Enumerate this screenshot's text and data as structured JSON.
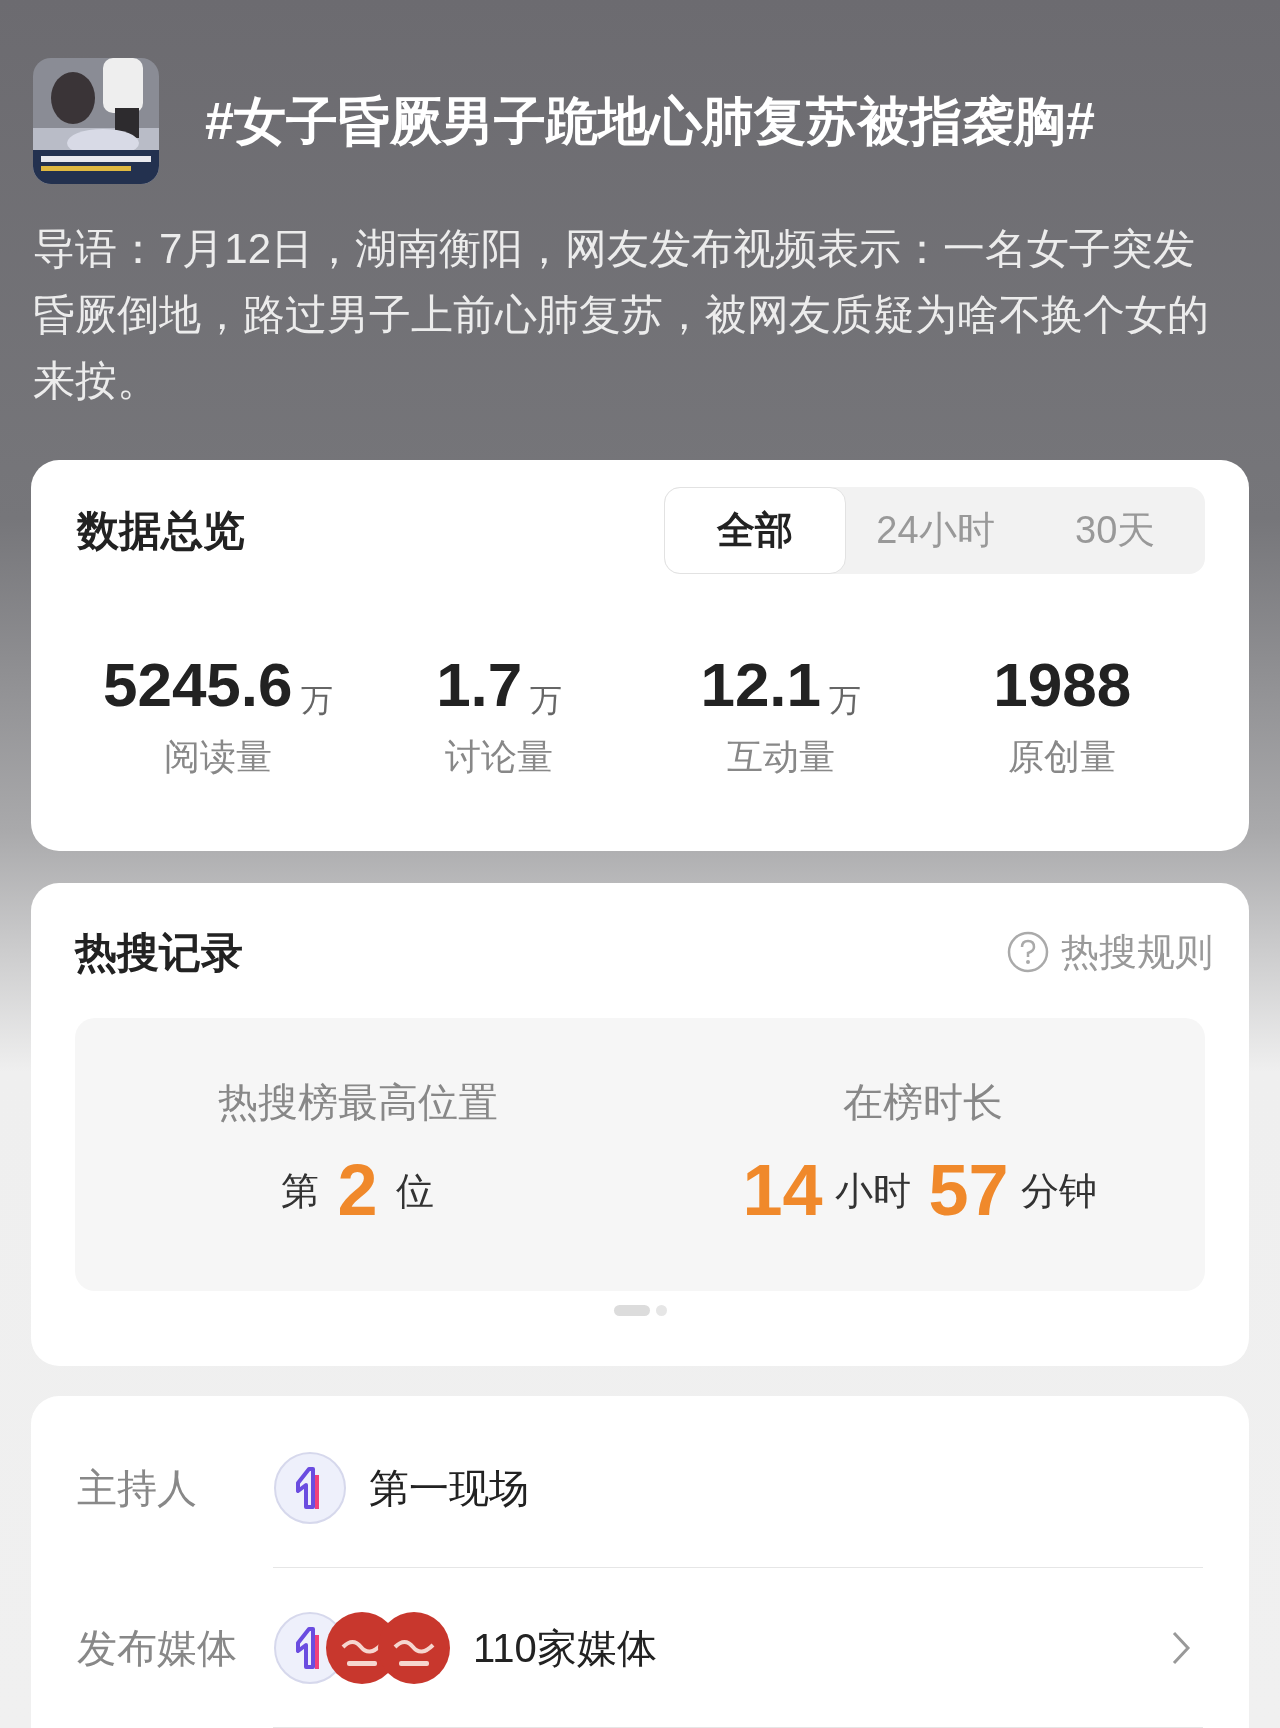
{
  "topic": {
    "title": "#女子昏厥男子跪地心肺复苏被指袭胸#",
    "intro": "导语：7月12日，湖南衡阳，网友发布视频表示：一名女子突发昏厥倒地，路过男子上前心肺复苏，被网友质疑为啥不换个女的来按。"
  },
  "overview": {
    "title": "数据总览",
    "tabs": [
      {
        "label": "全部",
        "selected": true
      },
      {
        "label": "24小时",
        "selected": false
      },
      {
        "label": "30天",
        "selected": false
      }
    ],
    "stats": [
      {
        "value": "5245.6",
        "unit": "万",
        "label": "阅读量"
      },
      {
        "value": "1.7",
        "unit": "万",
        "label": "讨论量"
      },
      {
        "value": "12.1",
        "unit": "万",
        "label": "互动量"
      },
      {
        "value": "1988",
        "label": "原创量"
      }
    ]
  },
  "hot_search": {
    "title": "热搜记录",
    "rules_link": "热搜规则",
    "highest_position": {
      "label": "热搜榜最高位置",
      "prefix": "第",
      "value": "2",
      "suffix": "位"
    },
    "duration": {
      "label": "在榜时长",
      "parts": [
        {
          "value": "14",
          "unit": "小时"
        },
        {
          "value": "57",
          "unit": "分钟"
        }
      ]
    },
    "pages": [
      {
        "selected": true
      },
      {
        "selected": false
      }
    ]
  },
  "info_rows": [
    {
      "label": "主持人",
      "avatars": [
        {
          "kind": "digit"
        }
      ],
      "text": "第一现场",
      "arrow": false
    },
    {
      "label": "发布媒体",
      "avatars": [
        {
          "kind": "digit"
        },
        {
          "kind": "red"
        },
        {
          "kind": "red"
        }
      ],
      "text": "110家媒体",
      "arrow": true
    }
  ]
}
